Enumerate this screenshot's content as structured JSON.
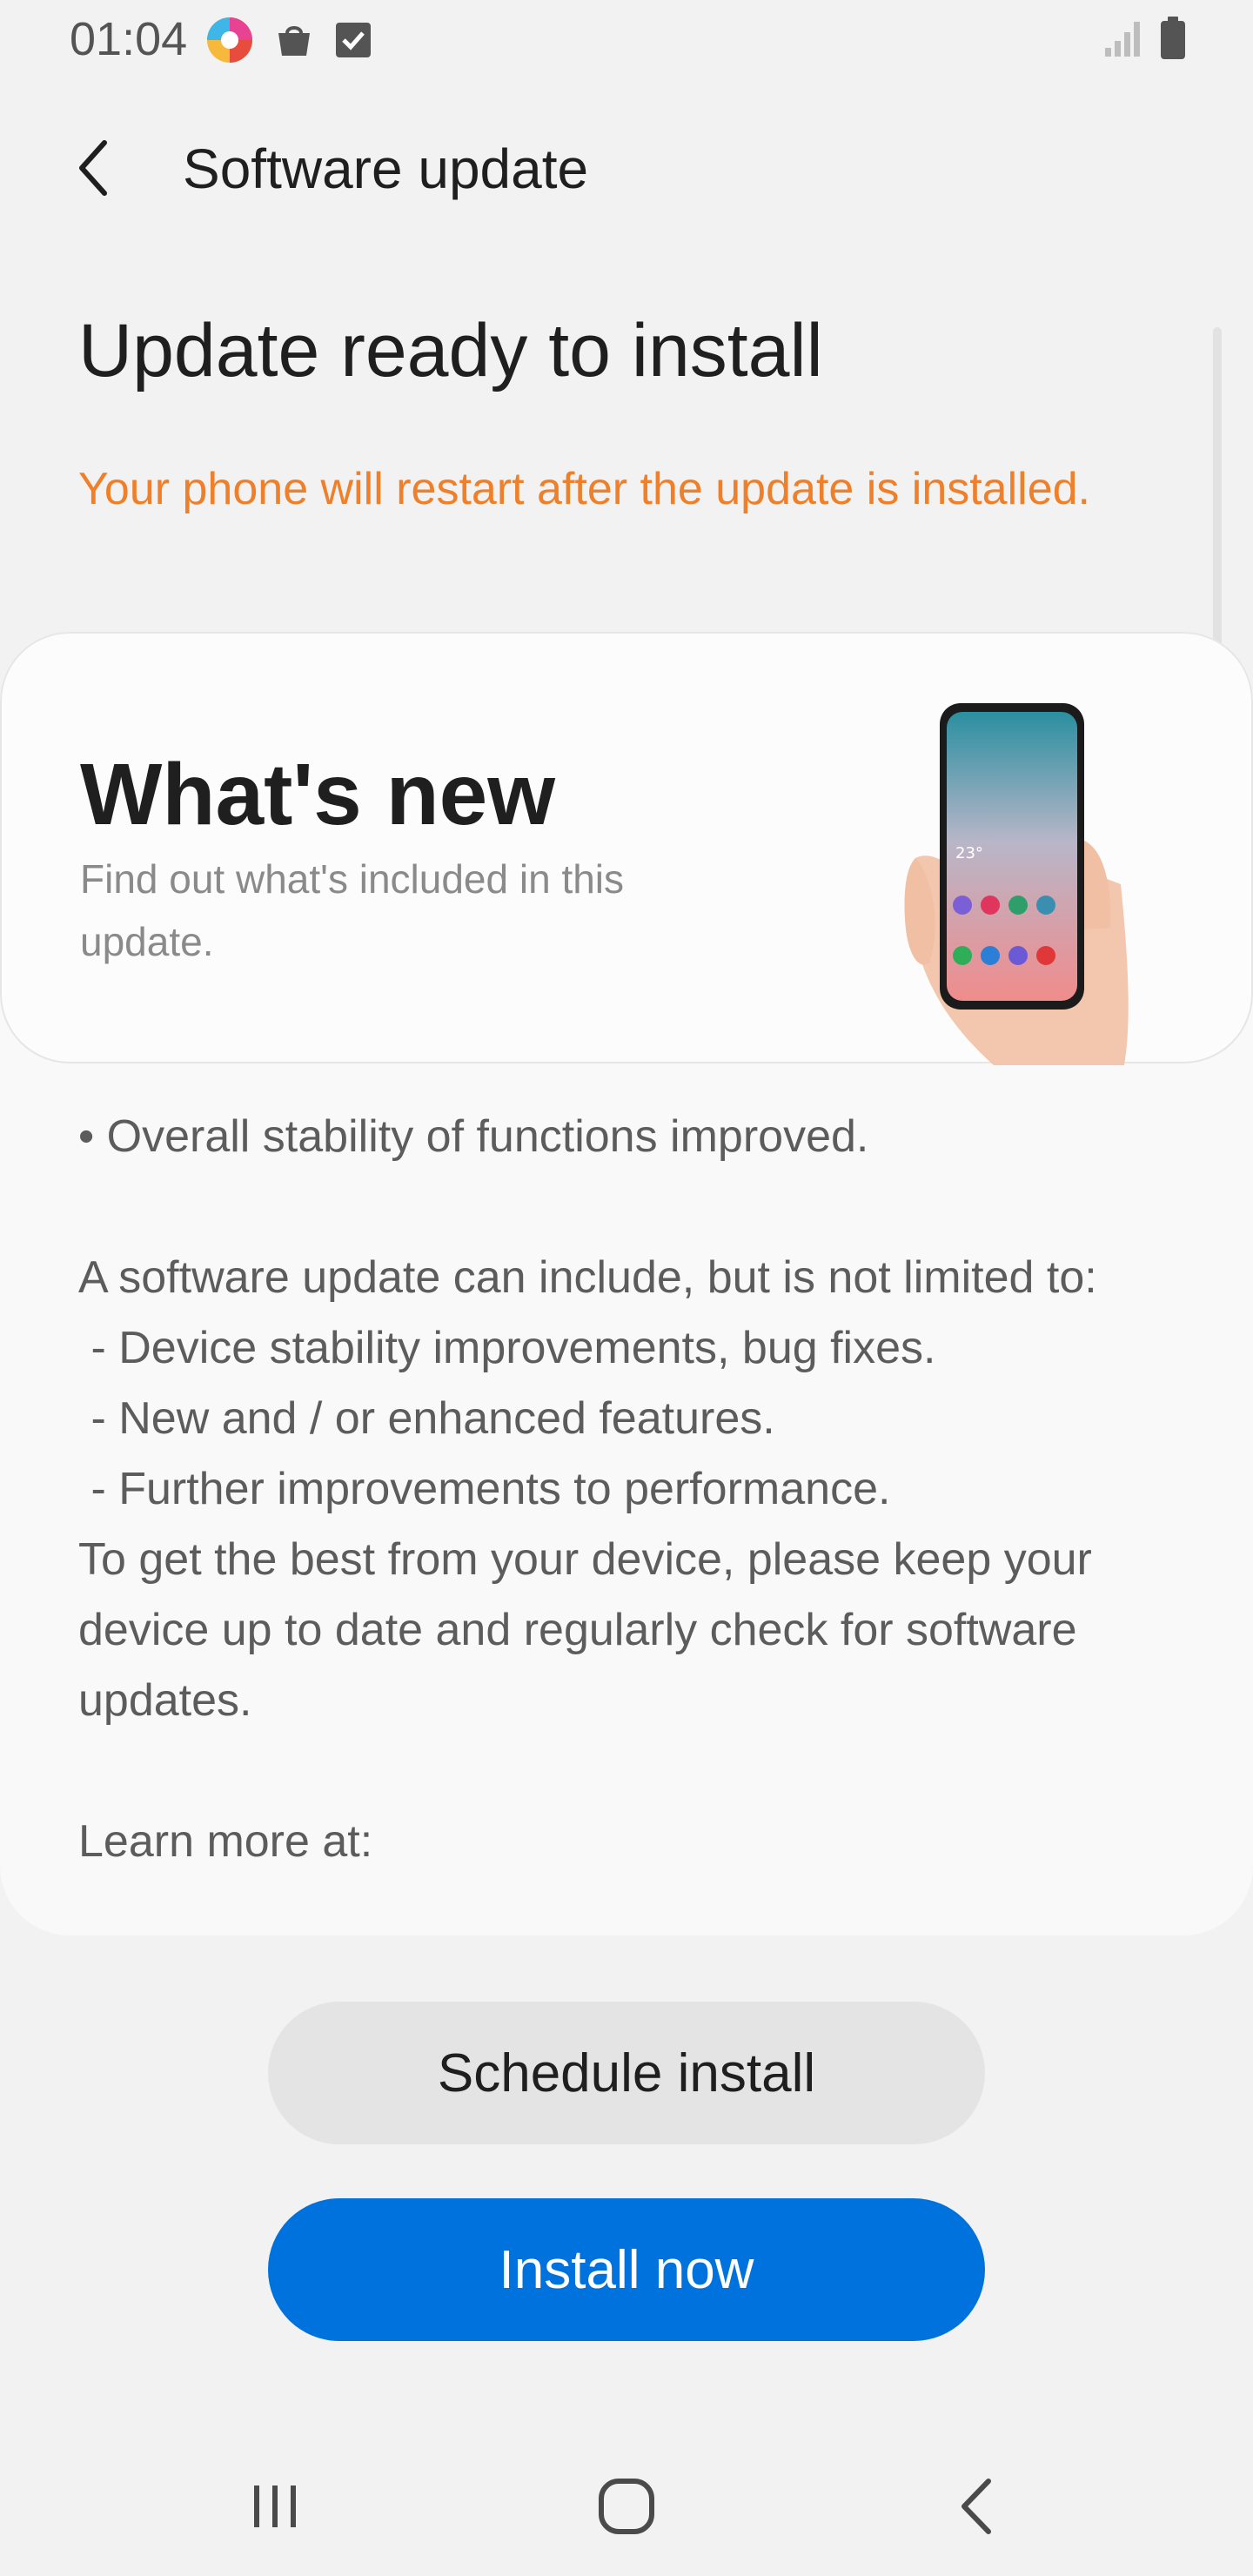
{
  "status_bar": {
    "time": "01:04",
    "left_icons": [
      "app-notification-icon",
      "shopping-bag-icon",
      "checkbox-icon"
    ],
    "right_icons": [
      "signal-icon",
      "battery-icon"
    ]
  },
  "header": {
    "title": "Software update"
  },
  "main": {
    "update_title": "Update ready to install",
    "restart_note": "Your phone will restart after the update is installed.",
    "accent_color": "#f07f2a"
  },
  "whats_new": {
    "title": "What's new",
    "subtitle": "Find out what's included in this update.",
    "phone_screen_temp": "23°"
  },
  "changelog": {
    "text": "• Overall stability of functions improved.\n\nA software update can include, but is not limited to:\n - Device stability improvements, bug fixes.\n - New and / or enhanced features.\n - Further improvements to performance.\nTo get the best from your device, please keep your device up to date and regularly check for software updates.\n\nLearn more at:"
  },
  "actions": {
    "schedule_label": "Schedule install",
    "install_label": "Install now",
    "install_color": "#0072de"
  },
  "nav": {
    "items": [
      "recent-apps-icon",
      "home-icon",
      "back-icon"
    ]
  }
}
